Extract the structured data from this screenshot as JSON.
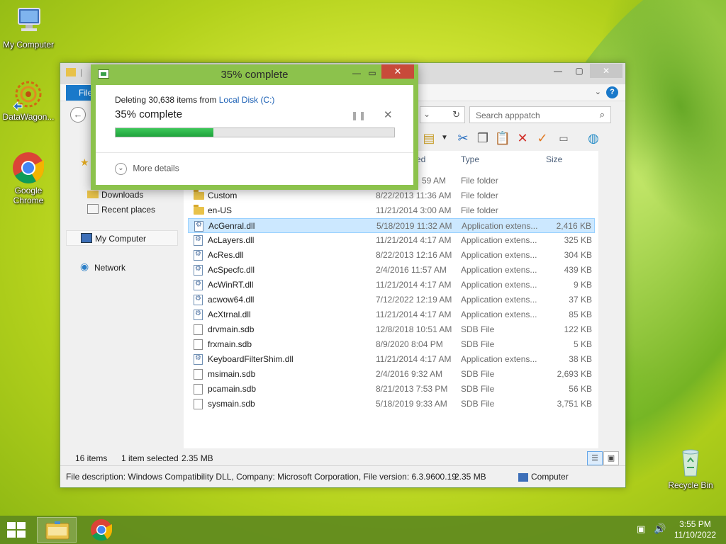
{
  "desktop": {
    "icons": [
      {
        "label": "My Computer"
      },
      {
        "label": "DataWagon..."
      },
      {
        "label": "Google Chrome"
      },
      {
        "label": "Recycle Bin"
      }
    ]
  },
  "explorer": {
    "file_tab": "File",
    "search_placeholder": "Search apppatch",
    "nav": {
      "downloads": "Downloads",
      "recent_places": "Recent places",
      "my_computer": "My Computer",
      "network": "Network"
    },
    "columns": {
      "modified_partial": "ed",
      "type": "Type",
      "size": "Size"
    },
    "first_row_partial": {
      "date": "59 AM",
      "type": "File folder"
    },
    "rows": [
      {
        "name": "Custom",
        "date": "8/22/2013 11:36 AM",
        "type": "File folder",
        "size": "",
        "kind": "folder"
      },
      {
        "name": "en-US",
        "date": "11/21/2014 3:00 AM",
        "type": "File folder",
        "size": "",
        "kind": "folder"
      },
      {
        "name": "AcGenral.dll",
        "date": "5/18/2019 11:32 AM",
        "type": "Application extens...",
        "size": "2,416 KB",
        "kind": "dll",
        "selected": true
      },
      {
        "name": "AcLayers.dll",
        "date": "11/21/2014 4:17 AM",
        "type": "Application extens...",
        "size": "325 KB",
        "kind": "dll"
      },
      {
        "name": "AcRes.dll",
        "date": "8/22/2013 12:16 AM",
        "type": "Application extens...",
        "size": "304 KB",
        "kind": "dll"
      },
      {
        "name": "AcSpecfc.dll",
        "date": "2/4/2016 11:57 AM",
        "type": "Application extens...",
        "size": "439 KB",
        "kind": "dll"
      },
      {
        "name": "AcWinRT.dll",
        "date": "11/21/2014 4:17 AM",
        "type": "Application extens...",
        "size": "9 KB",
        "kind": "dll"
      },
      {
        "name": "acwow64.dll",
        "date": "7/12/2022 12:19 AM",
        "type": "Application extens...",
        "size": "37 KB",
        "kind": "dll"
      },
      {
        "name": "AcXtrnal.dll",
        "date": "11/21/2014 4:17 AM",
        "type": "Application extens...",
        "size": "85 KB",
        "kind": "dll"
      },
      {
        "name": "drvmain.sdb",
        "date": "12/8/2018 10:51 AM",
        "type": "SDB File",
        "size": "122 KB",
        "kind": "file"
      },
      {
        "name": "frxmain.sdb",
        "date": "8/9/2020 8:04 PM",
        "type": "SDB File",
        "size": "5 KB",
        "kind": "file"
      },
      {
        "name": "KeyboardFilterShim.dll",
        "date": "11/21/2014 4:17 AM",
        "type": "Application extens...",
        "size": "38 KB",
        "kind": "dll"
      },
      {
        "name": "msimain.sdb",
        "date": "2/4/2016 9:32 AM",
        "type": "SDB File",
        "size": "2,693 KB",
        "kind": "file"
      },
      {
        "name": "pcamain.sdb",
        "date": "8/21/2013 7:53 PM",
        "type": "SDB File",
        "size": "56 KB",
        "kind": "file"
      },
      {
        "name": "sysmain.sdb",
        "date": "5/18/2019 9:33 AM",
        "type": "SDB File",
        "size": "3,751 KB",
        "kind": "file"
      }
    ],
    "status": {
      "items": "16 items",
      "selected": "1 item selected",
      "size": "2.35 MB"
    },
    "details_bar": {
      "description": "File description: Windows Compatibility DLL, Company: Microsoft Corporation, File version: 6.3.9600.19",
      "size": "2.35 MB",
      "location": "Computer"
    }
  },
  "dialog": {
    "title": "35% complete",
    "deleting_prefix": "Deleting 30,638 items from",
    "source": "Local Disk (C:)",
    "percent_text": "35% complete",
    "progress": 0.35,
    "more_details": "More details"
  },
  "taskbar": {
    "time": "3:55 PM",
    "date": "11/10/2022"
  },
  "colors": {
    "accent": "#1979ca",
    "dialog_frame": "#8cc24c",
    "progress_fill": "#2bb34a",
    "selection": "#cce8ff",
    "taskbar": "#608a1e"
  }
}
